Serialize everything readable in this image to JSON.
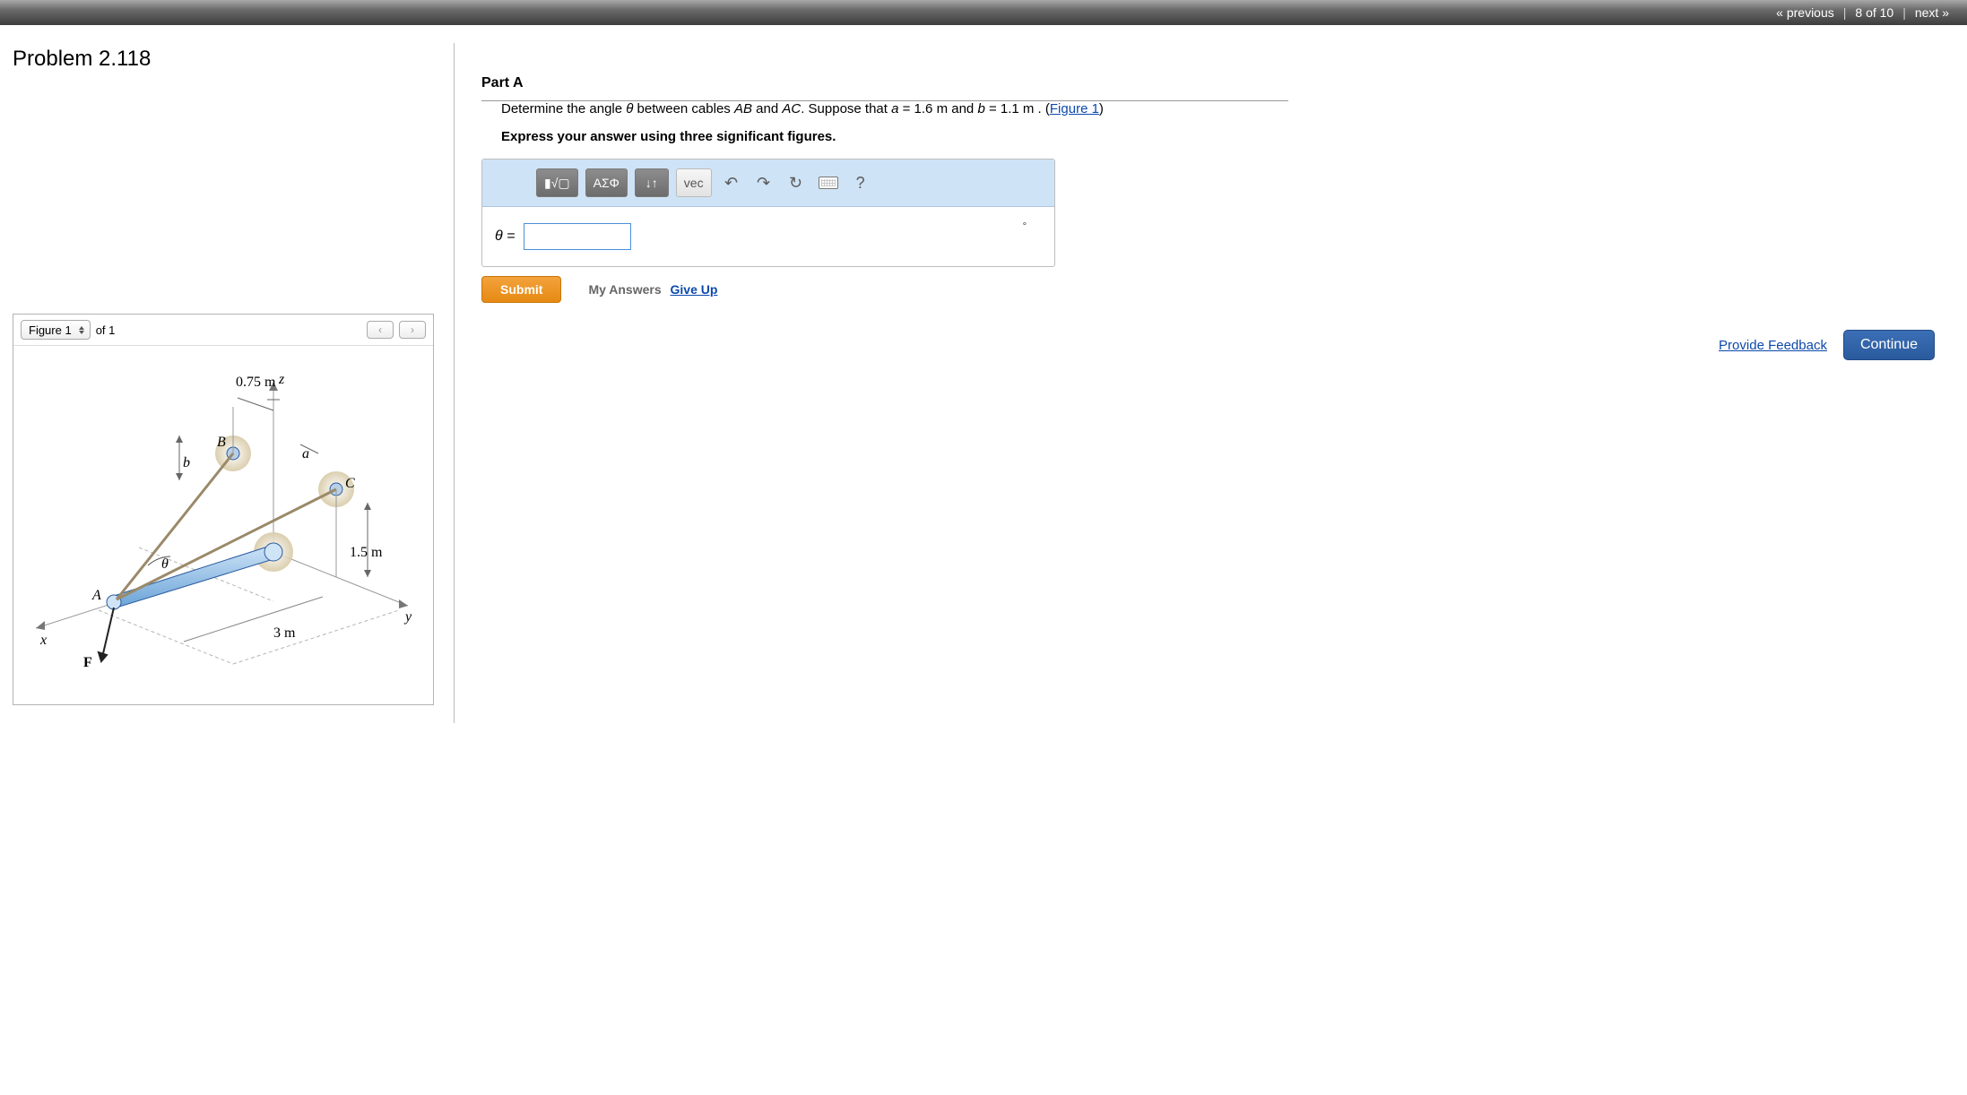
{
  "nav": {
    "prev": "« previous",
    "count": "8 of 10",
    "next": "next »"
  },
  "problem": {
    "title": "Problem 2.118"
  },
  "figure_panel": {
    "select_label": "Figure 1",
    "of_text": "of 1",
    "prev_glyph": "‹",
    "next_glyph": "›"
  },
  "figure": {
    "z_dim": "0.75 m",
    "y_dim": "1.5 m",
    "x_dim": "3 m",
    "axis_x": "x",
    "axis_y": "y",
    "axis_z": "z",
    "point_A": "A",
    "point_B": "B",
    "point_C": "C",
    "var_a": "a",
    "var_b": "b",
    "theta": "θ",
    "force": "F"
  },
  "part": {
    "label": "Part A",
    "prompt_pre": "Determine the angle ",
    "prompt_theta": "θ",
    "prompt_mid1": " between cables ",
    "prompt_AB": "AB",
    "prompt_mid2": " and ",
    "prompt_AC": "AC",
    "prompt_mid3": ". Suppose that ",
    "prompt_a": "a",
    "prompt_aval": " = 1.6  m",
    "prompt_mid4": " and ",
    "prompt_b": "b",
    "prompt_bval": " = 1.1  m",
    "prompt_end": " . (",
    "figure_link": "Figure 1",
    "prompt_close": ")",
    "instruction": "Express your answer using three significant figures."
  },
  "toolbar": {
    "templates": "▮√▢",
    "greek": "ΑΣΦ",
    "subsup": "↓↑",
    "vec": "vec",
    "undo": "↶",
    "redo": "↷",
    "reset": "↻",
    "help": "?"
  },
  "answer": {
    "lhs": "θ =",
    "value": "",
    "unit_mark": "∘"
  },
  "actions": {
    "submit": "Submit",
    "my_answers": "My Answers",
    "give_up": "Give Up"
  },
  "footer": {
    "feedback": "Provide Feedback",
    "continue": "Continue"
  }
}
